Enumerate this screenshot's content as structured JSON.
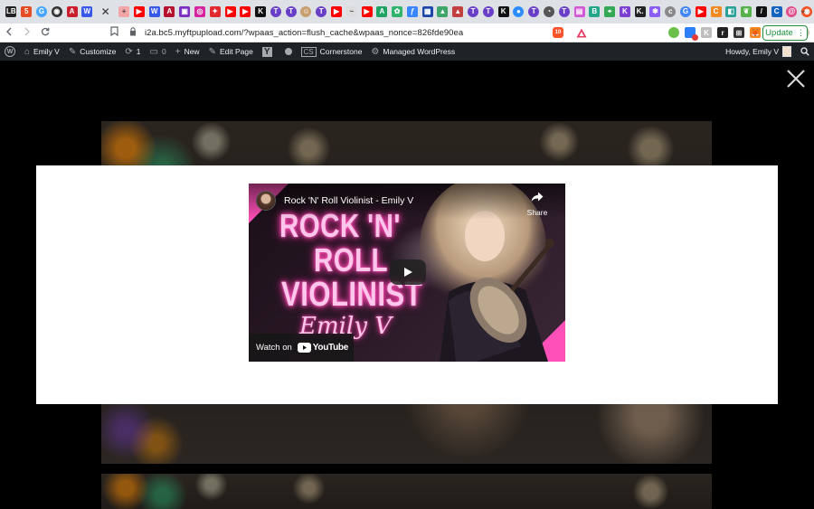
{
  "browser": {
    "tabs": [
      {
        "icon": "lb-icon",
        "glyph": "LB",
        "color": "#222222"
      },
      {
        "icon": "html5-icon",
        "glyph": "5",
        "color": "#e44d26"
      },
      {
        "icon": "globe-icon",
        "glyph": "G",
        "color": "#46a6ff"
      },
      {
        "icon": "circle-icon",
        "glyph": "◉",
        "color": "#333333"
      },
      {
        "icon": "a-logo-icon",
        "glyph": "A",
        "color": "#cc1f2d"
      },
      {
        "icon": "wordpress-icon",
        "glyph": "W",
        "color": "#3858e9"
      },
      {
        "icon": "active-tab-close-icon",
        "glyph": "✕",
        "color": "transparent"
      },
      {
        "icon": "plus-badge-icon",
        "glyph": "+",
        "color": "#f4a6a6"
      },
      {
        "icon": "youtube-icon",
        "glyph": "▶",
        "color": "#ff0000"
      },
      {
        "icon": "wordpress-icon",
        "glyph": "W",
        "color": "#3858e9"
      },
      {
        "icon": "a-logo-icon",
        "glyph": "A",
        "color": "#b3112e"
      },
      {
        "icon": "purple-icon",
        "glyph": "▣",
        "color": "#7b2fbf"
      },
      {
        "icon": "instagram-icon",
        "glyph": "◎",
        "color": "#d6249f"
      },
      {
        "icon": "red-badge-icon",
        "glyph": "✦",
        "color": "#e0292f"
      },
      {
        "icon": "youtube-icon",
        "glyph": "▶",
        "color": "#ff0000"
      },
      {
        "icon": "youtube-icon",
        "glyph": "▶",
        "color": "#ff0000"
      },
      {
        "icon": "black-k-icon",
        "glyph": "K",
        "color": "#111111"
      },
      {
        "icon": "t-circle-icon",
        "glyph": "T",
        "color": "#6a3fc8"
      },
      {
        "icon": "t-circle-icon",
        "glyph": "T",
        "color": "#6a3fc8"
      },
      {
        "icon": "person-icon",
        "glyph": "☺",
        "color": "#c8a070"
      },
      {
        "icon": "t-circle-icon",
        "glyph": "T",
        "color": "#6a3fc8"
      },
      {
        "icon": "youtube-icon",
        "glyph": "▶",
        "color": "#ff0000"
      },
      {
        "icon": "signature-icon",
        "glyph": "~",
        "color": "#dddddd"
      },
      {
        "icon": "youtube-icon",
        "glyph": "▶",
        "color": "#ff0000"
      },
      {
        "icon": "green-a-icon",
        "glyph": "A",
        "color": "#1ea362"
      },
      {
        "icon": "vine-icon",
        "glyph": "✿",
        "color": "#2fb46a"
      },
      {
        "icon": "f-icon",
        "glyph": "ƒ",
        "color": "#3a86ff"
      },
      {
        "icon": "calendar-icon",
        "glyph": "▦",
        "color": "#1a47a8"
      },
      {
        "icon": "green-mountain-icon",
        "glyph": "▲",
        "color": "#3fa66a"
      },
      {
        "icon": "red-mountain-icon",
        "glyph": "▲",
        "color": "#c24040"
      },
      {
        "icon": "t-circle-icon",
        "glyph": "T",
        "color": "#6a3fc8"
      },
      {
        "icon": "t-circle-icon",
        "glyph": "T",
        "color": "#6a3fc8"
      },
      {
        "icon": "black-k-icon",
        "glyph": "K",
        "color": "#111111"
      },
      {
        "icon": "blue-chat-icon",
        "glyph": "●",
        "color": "#2d8cff"
      },
      {
        "icon": "t-circle-icon",
        "glyph": "T",
        "color": "#6a3fc8"
      },
      {
        "icon": "gauge-icon",
        "glyph": "◔",
        "color": "#555555"
      },
      {
        "icon": "t-circle-icon",
        "glyph": "T",
        "color": "#6a3fc8"
      },
      {
        "icon": "pink-grid-icon",
        "glyph": "▤",
        "color": "#d35ad6"
      },
      {
        "icon": "teal-square-icon",
        "glyph": "B",
        "color": "#23a68a"
      },
      {
        "icon": "maps-pin-icon",
        "glyph": "⌖",
        "color": "#34a853"
      },
      {
        "icon": "purple-k-icon",
        "glyph": "K",
        "color": "#7c3fd1"
      },
      {
        "icon": "black-k-icon",
        "glyph": "K.",
        "color": "#222222"
      },
      {
        "icon": "star-icon",
        "glyph": "✱",
        "color": "#8b5cf6"
      },
      {
        "icon": "c-icon",
        "glyph": "c",
        "color": "#888888"
      },
      {
        "icon": "google-icon",
        "glyph": "G",
        "color": "#4285f4"
      },
      {
        "icon": "youtube-icon",
        "glyph": "▶",
        "color": "#ff0000"
      },
      {
        "icon": "orange-c-icon",
        "glyph": "C",
        "color": "#f08a24"
      },
      {
        "icon": "teal-icon",
        "glyph": "◧",
        "color": "#2aa198"
      },
      {
        "icon": "leaf-icon",
        "glyph": "❦",
        "color": "#55b14a"
      },
      {
        "icon": "slash-icon",
        "glyph": "/",
        "color": "#111111"
      },
      {
        "icon": "blue-c-icon",
        "glyph": "C",
        "color": "#1565c0"
      },
      {
        "icon": "spiral-icon",
        "glyph": "@",
        "color": "#e04e8a"
      },
      {
        "icon": "orange-chat-icon",
        "glyph": "◉",
        "color": "#f25022"
      },
      {
        "icon": "google-icon",
        "glyph": "G",
        "color": "#4285f4"
      }
    ],
    "new_tab_label": "+",
    "tab_menu_label": "⌄",
    "url": "i2a.bc5.myftpupload.com/?wpaas_action=flush_cache&wpaas_nonce=826fde90ea",
    "update_label": "Update",
    "brave_badge": "10"
  },
  "adminbar": {
    "site_name": "Emily V",
    "customize": "Customize",
    "updates_count": "1",
    "comments_count": "0",
    "new_label": "New",
    "edit_page": "Edit Page",
    "cornerstone": "Cornerstone",
    "managed_wp": "Managed WordPress",
    "howdy": "Howdy, Emily V"
  },
  "video": {
    "title": "Rock 'N' Roll Violinist - Emily V",
    "share_label": "Share",
    "watch_on": "Watch on",
    "youtube_word": "YouTube",
    "thumb_line1": "ROCK 'N'",
    "thumb_line2": "ROLL",
    "thumb_line3": "VIOLINIST",
    "thumb_script": "Emily V"
  },
  "colors": {
    "admin_bar": "#1d2327",
    "neon_pink": "#ff4fb8",
    "update_green": "#1e8e3e"
  }
}
